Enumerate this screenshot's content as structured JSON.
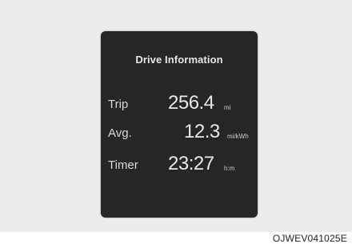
{
  "panel": {
    "title": "Drive Information",
    "rows": [
      {
        "label": "Trip",
        "value": "256.4",
        "unit": "mi"
      },
      {
        "label": "Avg.",
        "value": "12.3",
        "unit": "mi/kWh"
      },
      {
        "label": "Timer",
        "value": "23:27",
        "unit": "h:m"
      }
    ]
  },
  "caption": "OJWEV041025E"
}
